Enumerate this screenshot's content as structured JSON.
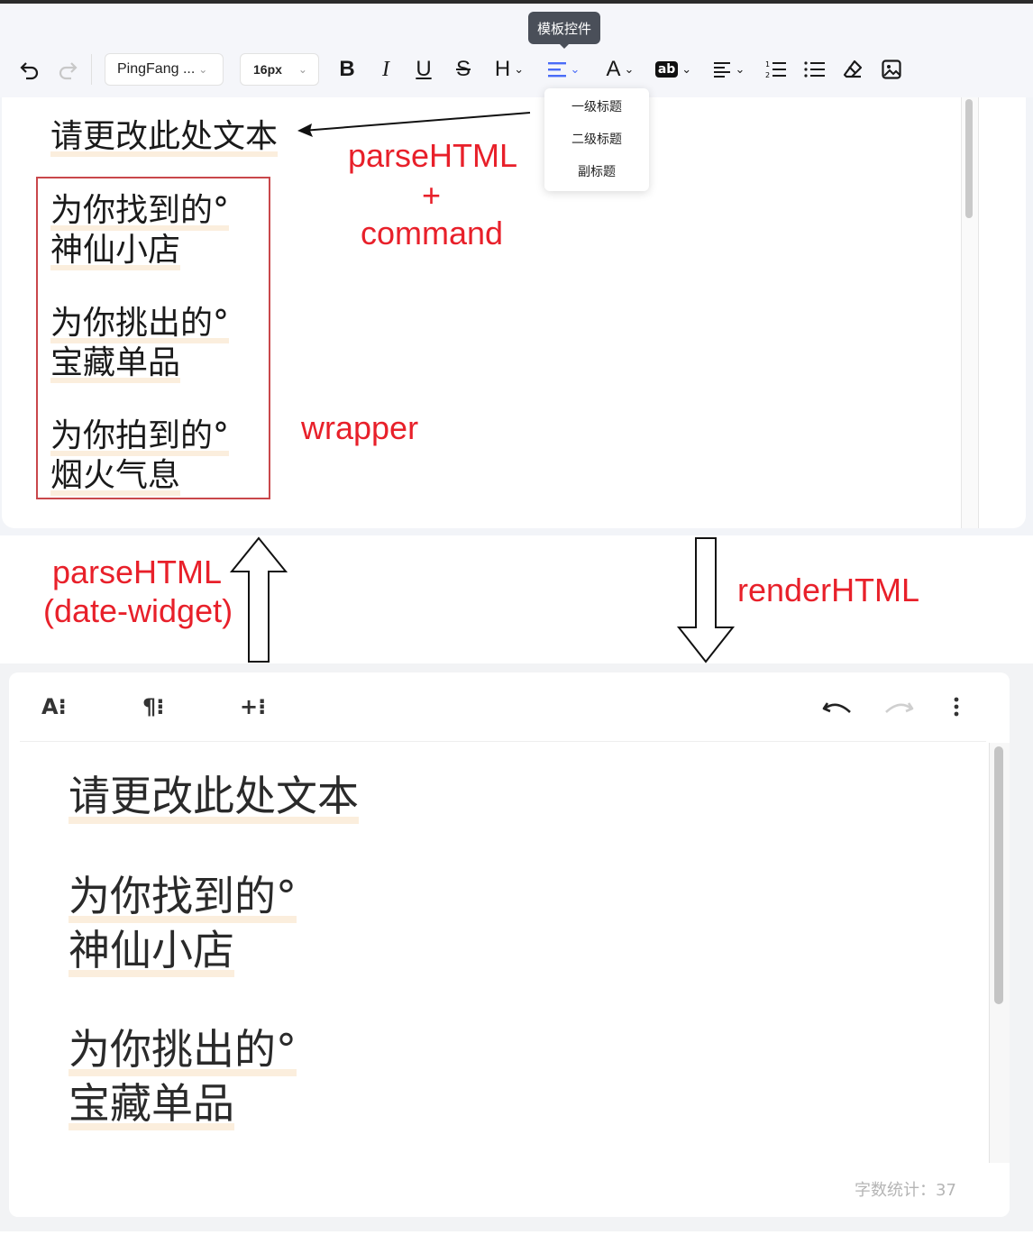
{
  "toolbar": {
    "font_family": "PingFang ...",
    "font_size": "16px",
    "tooltip": "模板控件",
    "heading_label": "H",
    "font_color_label": "A",
    "highlight_label": "ab",
    "dropdown_items": [
      "一级标题",
      "二级标题",
      "副标题"
    ]
  },
  "top_editor": {
    "title_line": "请更改此处文本",
    "wrapper_items": [
      [
        "为你找到的°",
        "神仙小店"
      ],
      [
        "为你挑出的°",
        "宝藏单品"
      ],
      [
        "为你拍到的°",
        "烟火气息"
      ]
    ]
  },
  "annotations": {
    "parse_line1": "parseHTML",
    "parse_plus": "+",
    "parse_line3": "command",
    "wrapper": "wrapper",
    "parse_widget_1": "parseHTML",
    "parse_widget_2": "(date-widget)",
    "render": "renderHTML"
  },
  "bottom_editor": {
    "toolbar_icons": [
      "A⁝",
      "¶⁝",
      "+⁝"
    ],
    "title_line": "请更改此处文本",
    "items": [
      [
        "为你找到的°",
        "神仙小店"
      ],
      [
        "为你挑出的°",
        "宝藏单品"
      ]
    ],
    "word_count": "字数统计：37"
  },
  "colors": {
    "annotation_red": "#e8202a",
    "wrapper_border": "#c9474b",
    "highlight": "#fbeedd",
    "active_icon": "#4a6cf7"
  }
}
